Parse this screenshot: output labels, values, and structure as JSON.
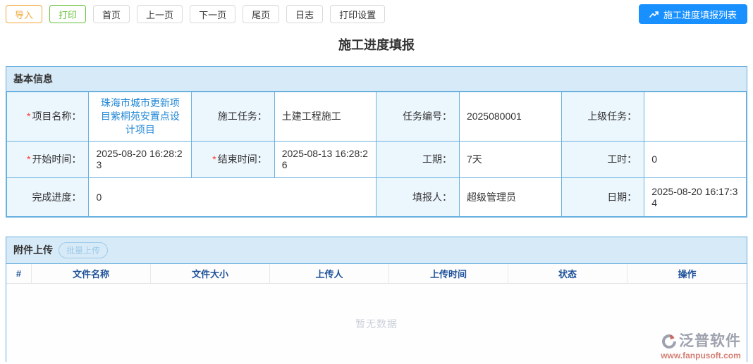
{
  "toolbar": {
    "buttons": [
      {
        "label": "导入",
        "style": "orange"
      },
      {
        "label": "打印",
        "style": "green"
      },
      {
        "label": "首页",
        "style": "default"
      },
      {
        "label": "上一页",
        "style": "default"
      },
      {
        "label": "下一页",
        "style": "default"
      },
      {
        "label": "尾页",
        "style": "default"
      },
      {
        "label": "日志",
        "style": "default"
      },
      {
        "label": "打印设置",
        "style": "default"
      }
    ],
    "list_button": {
      "label": "施工进度填报列表",
      "icon": "trending-up-icon"
    }
  },
  "page_title": "施工进度填报",
  "basic_info": {
    "section_title": "基本信息",
    "fields": {
      "project_name": {
        "required_mark": "*",
        "label": "项目名称：",
        "value": "珠海市城市更新项目紫桐苑安置点设计项目"
      },
      "task": {
        "label": "施工任务：",
        "value": "土建工程施工"
      },
      "task_no": {
        "label": "任务编号：",
        "value": "2025080001"
      },
      "parent_task": {
        "label": "上级任务：",
        "value": ""
      },
      "start_time": {
        "required_mark": "*",
        "label": "开始时间：",
        "value": "2025-08-20 16:28:23"
      },
      "end_time": {
        "required_mark": "*",
        "label": "结束时间：",
        "value": "2025-08-13 16:28:26"
      },
      "duration": {
        "label": "工期：",
        "value": "7天"
      },
      "work_hours": {
        "label": "工时：",
        "value": "0"
      },
      "progress": {
        "label": "完成进度：",
        "value": "0"
      },
      "reporter": {
        "label": "填报人：",
        "value": "超级管理员"
      },
      "date": {
        "label": "日期：",
        "value": "2025-08-20 16:17:34"
      }
    }
  },
  "attachments": {
    "section_title": "附件上传",
    "batch_upload_label": "批量上传",
    "columns": [
      "#",
      "文件名称",
      "文件大小",
      "上传人",
      "上传时间",
      "状态",
      "操作"
    ],
    "rows": [],
    "empty_text": "暂无数据"
  },
  "watermark": {
    "brand": "泛普软件",
    "url": "www.fanpusoft.com"
  },
  "colors": {
    "primary_blue": "#1890ff",
    "border_blue": "#6ab2e0",
    "section_header_bg": "#d7eaf7",
    "label_cell_bg": "#ecf6fd",
    "link_blue": "#1f86d6",
    "orange": "#f2a93b",
    "green": "#67c23a",
    "table_header_text": "#1c5199",
    "empty_gray": "#ccd0d9"
  }
}
